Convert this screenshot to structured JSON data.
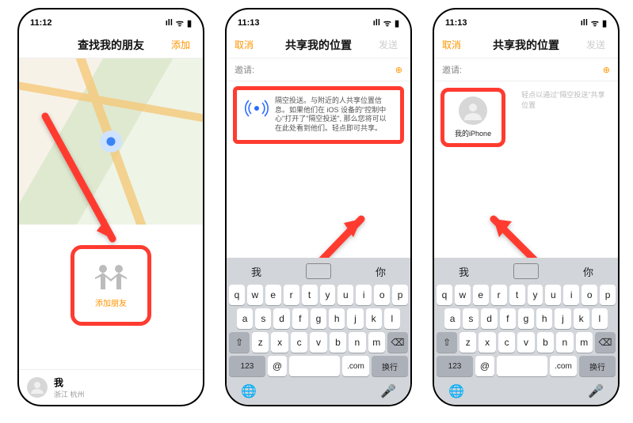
{
  "status1": {
    "time": "11:12",
    "battery": "▮"
  },
  "status2": {
    "time": "11:13",
    "battery": "▮"
  },
  "status3": {
    "time": "11:13",
    "battery": "▮"
  },
  "signal_glyph": "ıll",
  "wifi_glyph": "ᯤ",
  "screen1": {
    "nav": {
      "title": "查找我的朋友",
      "right": "添加"
    },
    "add_friends": "添加朋友",
    "me": {
      "name": "我",
      "location": "浙江 杭州"
    }
  },
  "screen2": {
    "nav": {
      "cancel": "取消",
      "title": "共享我的位置",
      "send": "发送"
    },
    "invite_label": "邀请:",
    "hint": "隔空投送。与附近的人共享位置信息。如果他们在 iOS 设备的\"控制中心\"打开了\"隔空投送\", 那么您将可以在此处看到他们。轻点即可共享。"
  },
  "screen3": {
    "nav": {
      "cancel": "取消",
      "title": "共享我的位置",
      "send": "发送"
    },
    "invite_label": "邀请:",
    "contact_name": "我的iPhone",
    "airdrop_hint": "轻点以通过\"隔空投送\"共享位置"
  },
  "keyboard": {
    "suggestions": [
      "我",
      "",
      "你"
    ],
    "row1": [
      "q",
      "w",
      "e",
      "r",
      "t",
      "y",
      "u",
      "i",
      "o",
      "p"
    ],
    "row2": [
      "a",
      "s",
      "d",
      "f",
      "g",
      "h",
      "j",
      "k",
      "l"
    ],
    "row3": [
      "z",
      "x",
      "c",
      "v",
      "b",
      "n",
      "m"
    ],
    "bottom": {
      "num": "123",
      "at": "@",
      "com": ".com",
      "return": "换行"
    }
  }
}
